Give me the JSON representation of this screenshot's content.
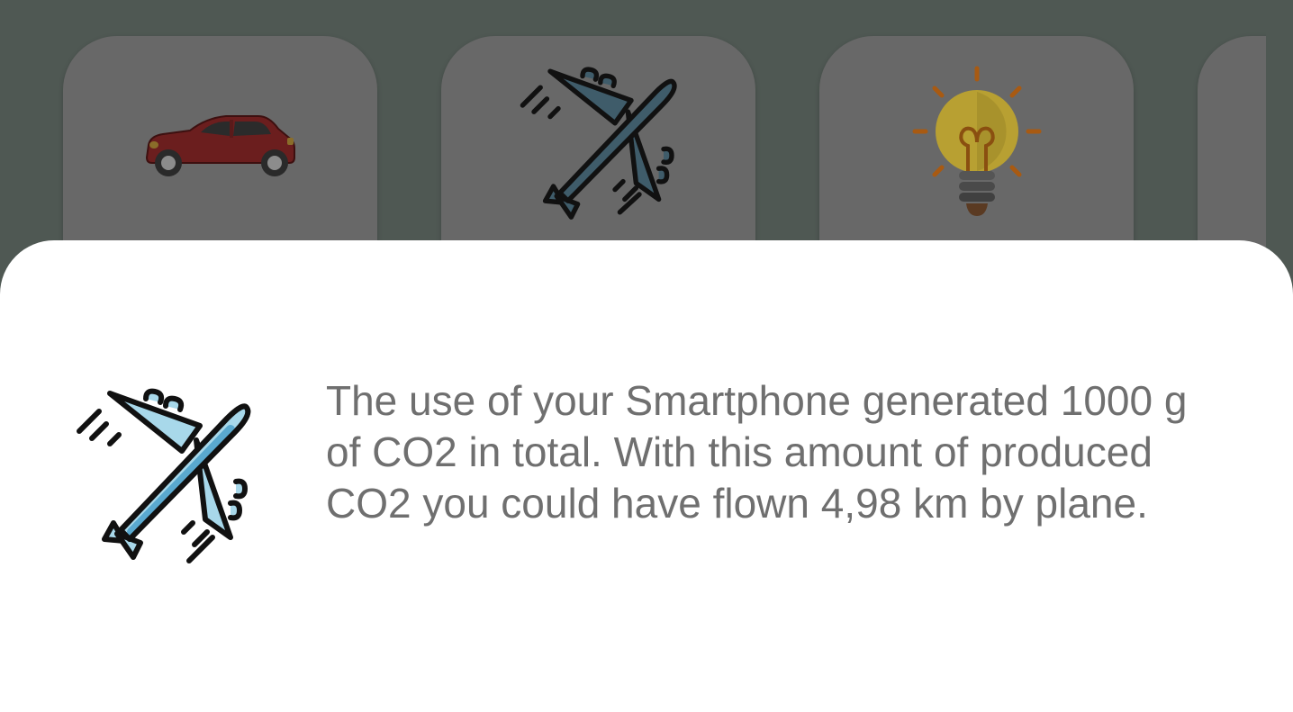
{
  "carousel": {
    "cards": [
      {
        "icon": "car-icon"
      },
      {
        "icon": "airplane-icon"
      },
      {
        "icon": "light-bulb-icon"
      },
      {
        "icon": ""
      }
    ]
  },
  "sheet": {
    "icon": "airplane-icon",
    "message": "The use of your Smartphone generated 1000 g of CO2 in total. With this amount of produced CO2 you could have flown 4,98 km by plane."
  },
  "colors": {
    "scrim": "#4f5853",
    "card": "#686868",
    "sheet": "#ffffff",
    "text": "#6f6f6f",
    "plane_dimmed": "#3f5c6a",
    "plane": "#a8d8ea",
    "car": "#6b1e1e",
    "bulb": "#b8a032"
  }
}
